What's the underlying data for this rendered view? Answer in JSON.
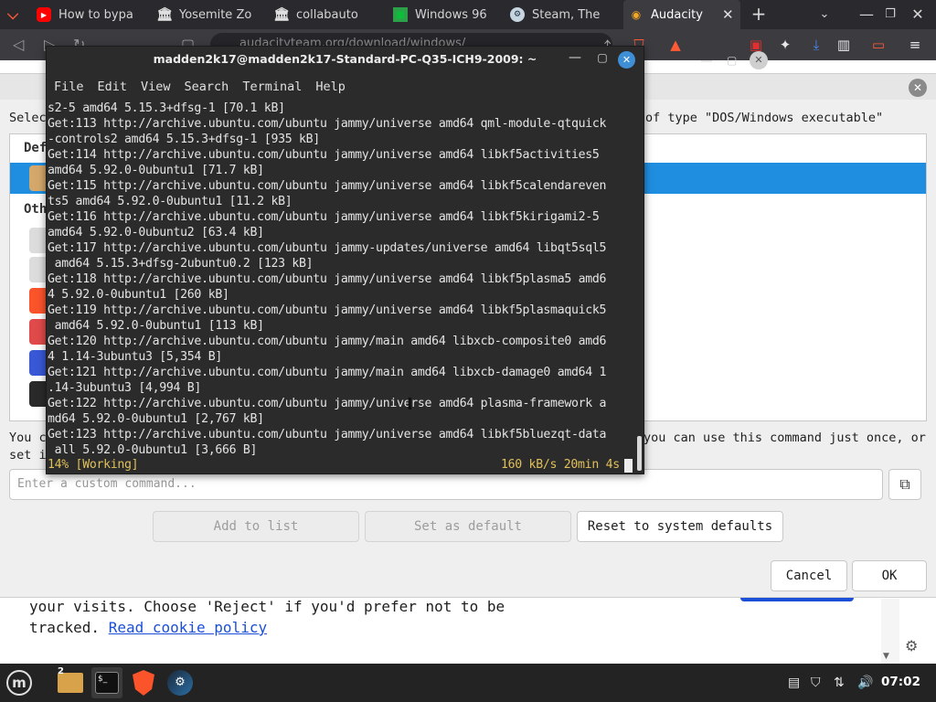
{
  "browser": {
    "tabs": [
      {
        "label": "How to bypa",
        "icon": "youtube-icon",
        "color": "#ff0000"
      },
      {
        "label": "Yosemite Zo",
        "icon": "museum-icon"
      },
      {
        "label": "collabauto",
        "icon": "museum-icon"
      },
      {
        "label": "Windows 96",
        "icon": "windows96-icon"
      },
      {
        "label": "Steam, The",
        "icon": "steam-icon"
      },
      {
        "label": "Audacity",
        "icon": "audacity-icon",
        "active": true
      }
    ],
    "new_tab": "+",
    "url": "audacityteam.org/download/windows/"
  },
  "webpage": {
    "cookie_line1": "your visits. Choose 'Reject' if you'd prefer not to be",
    "cookie_line2_prefix": "tracked. ",
    "cookie_link": "Read cookie policy"
  },
  "dialog": {
    "desc_left": "Selec",
    "desc_right": "of type \"DOS/Windows executable\"",
    "default_head": "Def",
    "other_head": "Oth",
    "bottom_left_1": "You c",
    "bottom_right_1": "you can use this command just once, or",
    "bottom_left_2": "set i",
    "custom_command_placeholder": "Enter a custom command...",
    "buttons": {
      "add": "Add to list",
      "set_default": "Set as default",
      "reset": "Reset to system defaults",
      "cancel": "Cancel",
      "ok": "OK"
    }
  },
  "terminal": {
    "title": "madden2k17@madden2k17-Standard-PC-Q35-ICH9-2009: ~",
    "menu": [
      "File",
      "Edit",
      "View",
      "Search",
      "Terminal",
      "Help"
    ],
    "lines": [
      "s2-5 amd64 5.15.3+dfsg-1 [70.1 kB]",
      "Get:113 http://archive.ubuntu.com/ubuntu jammy/universe amd64 qml-module-qtquick",
      "-controls2 amd64 5.15.3+dfsg-1 [935 kB]",
      "Get:114 http://archive.ubuntu.com/ubuntu jammy/universe amd64 libkf5activities5",
      "amd64 5.92.0-0ubuntu1 [71.7 kB]",
      "Get:115 http://archive.ubuntu.com/ubuntu jammy/universe amd64 libkf5calendareven",
      "ts5 amd64 5.92.0-0ubuntu1 [11.2 kB]",
      "Get:116 http://archive.ubuntu.com/ubuntu jammy/universe amd64 libkf5kirigami2-5",
      "amd64 5.92.0-0ubuntu2 [63.4 kB]",
      "Get:117 http://archive.ubuntu.com/ubuntu jammy-updates/universe amd64 libqt5sql5",
      " amd64 5.15.3+dfsg-2ubuntu0.2 [123 kB]",
      "Get:118 http://archive.ubuntu.com/ubuntu jammy/universe amd64 libkf5plasma5 amd6",
      "4 5.92.0-0ubuntu1 [260 kB]",
      "Get:119 http://archive.ubuntu.com/ubuntu jammy/universe amd64 libkf5plasmaquick5",
      " amd64 5.92.0-0ubuntu1 [113 kB]",
      "Get:120 http://archive.ubuntu.com/ubuntu jammy/main amd64 libxcb-composite0 amd6",
      "4 1.14-3ubuntu3 [5,354 B]",
      "Get:121 http://archive.ubuntu.com/ubuntu jammy/main amd64 libxcb-damage0 amd64 1",
      ".14-3ubuntu3 [4,994 B]",
      "Get:122 http://archive.ubuntu.com/ubuntu jammy/universe amd64 plasma-framework a",
      "md64 5.92.0-0ubuntu1 [2,767 kB]",
      "Get:123 http://archive.ubuntu.com/ubuntu jammy/universe amd64 libkf5bluezqt-data",
      " all 5.92.0-0ubuntu1 [3,666 B]"
    ],
    "status_left": "14% [Working]",
    "status_right": "160 kB/s 20min 4s"
  },
  "taskbar": {
    "workspace_badge": "2",
    "clock": "07:02"
  }
}
